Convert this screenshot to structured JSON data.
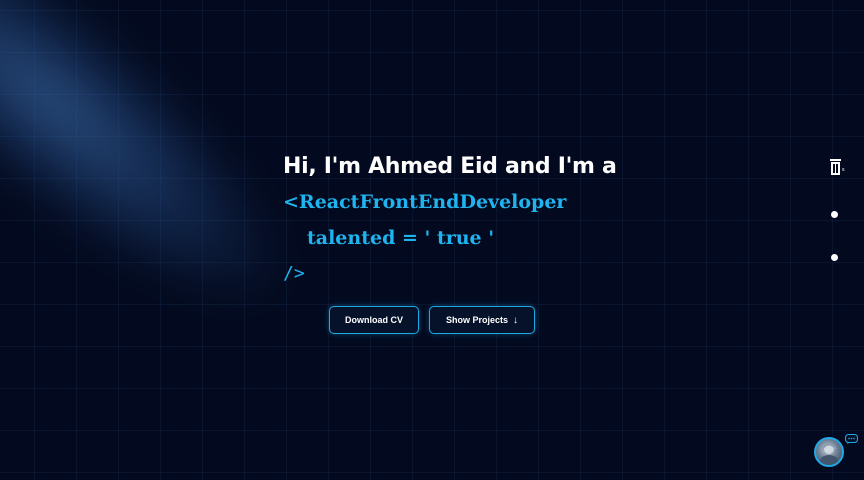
{
  "hero": {
    "greeting": "Hi, I'm Ahmed Eid and I'm a",
    "code_open": "<ReactFrontEndDeveloper",
    "code_prop": "talented = ' true '",
    "code_close": "/>"
  },
  "buttons": {
    "download_cv": "Download CV",
    "show_projects": "Show Projects",
    "show_projects_icon": "arrow-down-icon"
  },
  "side_nav": {
    "icon": "code-tag-icon",
    "dots": 2
  },
  "chat": {
    "avatar": "avatar",
    "icon": "chat-bubble-icon"
  },
  "colors": {
    "background": "#030a1f",
    "accent": "#1fb4ef",
    "text": "#ffffff"
  }
}
